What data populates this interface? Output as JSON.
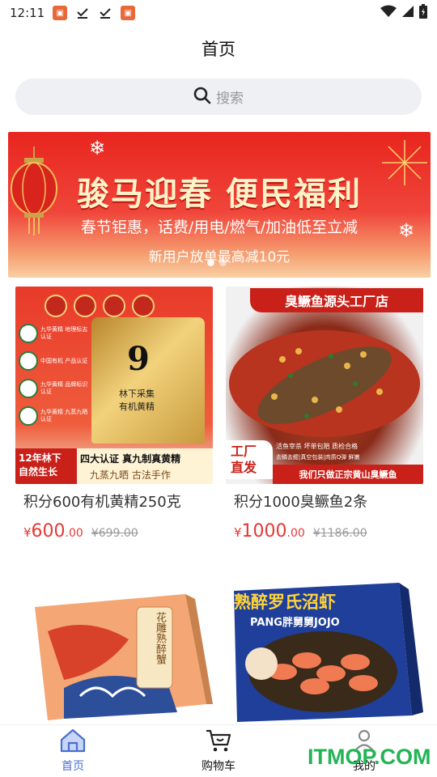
{
  "status_bar": {
    "time": "12:11",
    "icons": [
      "app-notification-icon",
      "download-done-icon",
      "download-done-icon",
      "app-notification-icon",
      "wifi-icon",
      "signal-icon",
      "battery-icon"
    ]
  },
  "header": {
    "title": "首页"
  },
  "search": {
    "placeholder": "搜索",
    "icon": "search-icon"
  },
  "banner": {
    "headline": "骏马迎春 便民福利",
    "subline": "春节钜惠，话费/用电/燃气/加油低至立减",
    "promo": "新用户放单最高减10元",
    "slide_count": 2,
    "active_slide": 1
  },
  "products": [
    {
      "name": "积分600有机黄精250克",
      "price_symbol": "¥",
      "price_int": "600",
      "price_dec": ".00",
      "original_price": "¥699.00",
      "image_text": {
        "bag_number": "9",
        "bag_line1": "林下采集",
        "bag_line2": "有机黄精",
        "certs": [
          "九华黄精 地理标志认证",
          "中国有机 产品认证",
          "九华黄精 品牌标识认证",
          "九华黄精 九蒸九晒认证"
        ],
        "footer_left": "12年林下 自然生长",
        "footer_right1": "四大认证 真九制真黄精",
        "footer_right2": "九蒸九晒 古法手作"
      }
    },
    {
      "name": "积分1000臭鳜鱼2条",
      "price_symbol": "¥",
      "price_int": "1000",
      "price_dec": ".00",
      "original_price": "¥1186.00",
      "image_text": {
        "top_banner": "臭鳜鱼源头工厂店",
        "corner": "工厂 直发",
        "tags": "活鱼宰杀 坏单包赔 质检合格",
        "tags2": "去鳞去鳃|真空包装|肉质Q弹 鲜嫩",
        "slogan": "我们只做正宗黄山臭鳜鱼"
      }
    },
    {
      "name": "",
      "image_text": {
        "box_label": "花雕熟醉蟹"
      }
    },
    {
      "name": "",
      "image_text": {
        "title": "熟醉罗氏沼虾",
        "brand": "PANG胖舅舅JOJO"
      }
    }
  ],
  "bottom_nav": {
    "items": [
      {
        "label": "首页",
        "icon": "home-icon",
        "active": true
      },
      {
        "label": "购物车",
        "icon": "cart-icon",
        "active": false
      },
      {
        "label": "我的",
        "icon": "user-icon",
        "active": false
      }
    ]
  },
  "watermark": "ITMOP.COM",
  "colors": {
    "accent": "#4a6fd0",
    "price": "#e53935",
    "search_bg": "#eef0f4",
    "banner_red": "#e8251f",
    "watermark": "#22b455"
  }
}
